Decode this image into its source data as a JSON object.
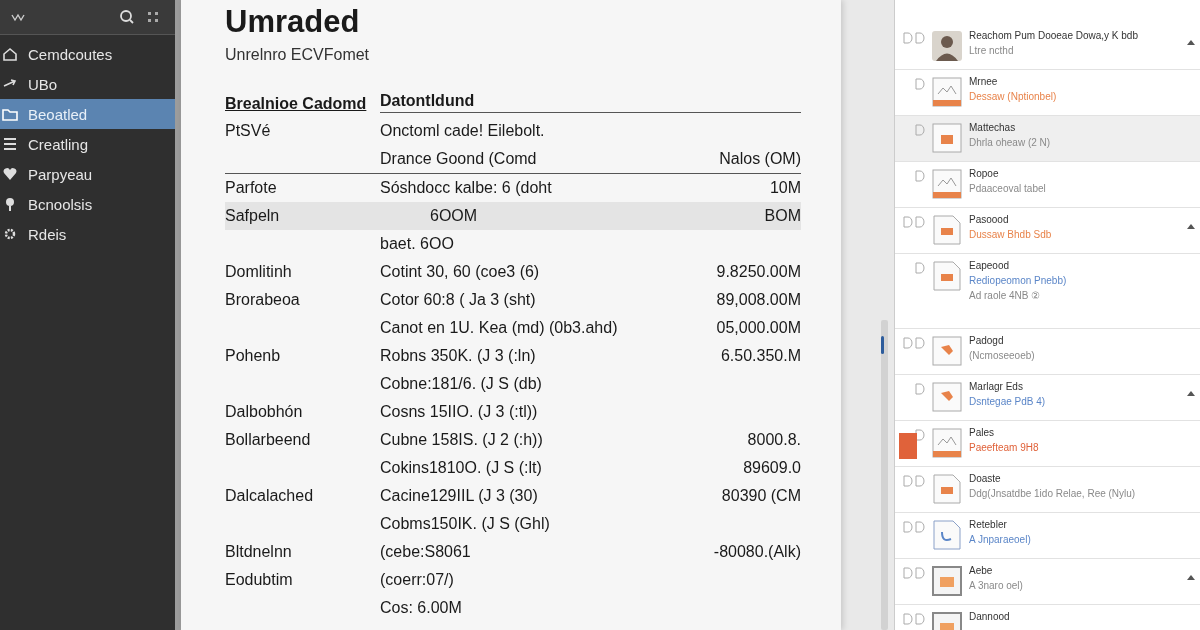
{
  "sidebar": {
    "items": [
      {
        "label": "Cemdcoutes",
        "selected": false
      },
      {
        "label": "UBo",
        "selected": false
      },
      {
        "label": "Beoatled",
        "selected": true
      },
      {
        "label": "Creatling",
        "selected": false
      },
      {
        "label": "Parpyeau",
        "selected": false
      },
      {
        "label": "Bcnoolsis",
        "selected": false
      },
      {
        "label": "Rdeis",
        "selected": false
      }
    ]
  },
  "document": {
    "title": "Umraded",
    "subtitle": "Unrelnro ECVFomet",
    "header": {
      "column_1": "Brealnioe Cadomd",
      "column_2": "Datontldund"
    },
    "rows": [
      {
        "label": "PtSVé",
        "detail": "Onctoml cade! Eilebolt."
      },
      {
        "detail": "Drance Goond (Comd",
        "value": "Nalos (OM)",
        "rule": true
      },
      {
        "label": "Parfote",
        "detail": "Sóshdocc kalbe: 6 (doht",
        "value": "10M"
      },
      {
        "label": "Safpeln",
        "detail": "6OOM",
        "value": "BOM",
        "shaded": true
      },
      {
        "detail": "baet. 6OO"
      },
      {
        "label": "Domlitinh",
        "detail": "Cotint 30, 60 (coe3 (6)",
        "value": "9.8250.00M"
      },
      {
        "label": "Brorabeoa",
        "detail": "Cotor 60:8 ( Ja 3 (sht)",
        "value": "89,008.00M"
      },
      {
        "detail": "Canot en 1U. Kea (md) (0b3.ahd)",
        "value": "05,000.00M"
      },
      {
        "label": "Pohenb",
        "detail": "Robns 350K. (J 3 (:ln)",
        "value": "6.50.350.M"
      },
      {
        "detail": "Cobne:181/6. (J S (db)"
      },
      {
        "label": "Dalbobhón",
        "detail": "Cosns 15IIO. (J 3 (:tl))"
      },
      {
        "label": "Bollarbeend",
        "detail": "Cubne 158IS. (J 2 (:h))",
        "value": "8000.8."
      },
      {
        "detail": "Cokins1810O. (J S (:lt)",
        "value": "89609.0"
      },
      {
        "label": "Dalcalached",
        "detail": "Cacine129IIL (J 3 (30)",
        "value": "80390 (CM"
      },
      {
        "detail": "Cobms150IK. (J S (Ghl)"
      },
      {
        "label": "Bltdnelnn",
        "detail": "(cebe:S8061",
        "value": "-80080.(Alk)"
      },
      {
        "label": "Eodubtim",
        "detail": "(coerr:07/)"
      },
      {
        "detail": "Cos: 6.00M"
      }
    ]
  },
  "list": {
    "items": [
      {
        "title": "Reachom Pum Dooeae Dowa,y K bdb",
        "subtitle": "Ltre ncthd",
        "kind": "plain",
        "expanded": true,
        "selected": false,
        "flagged": false
      },
      {
        "title": "Mrnee",
        "subtitle": "Dessaw (Nptionbel)",
        "kind": "accent",
        "expanded": false,
        "selected": false,
        "flagged": false
      },
      {
        "title": "Mattechas",
        "subtitle": "Dhrla oheaw (2 N)",
        "kind": "plain",
        "expanded": false,
        "selected": true,
        "flagged": false
      },
      {
        "title": "Ropoe",
        "subtitle": "Pdaaceoval tabel",
        "kind": "plain",
        "expanded": false,
        "selected": false,
        "flagged": false
      },
      {
        "title": "Pasoood",
        "subtitle": "Dussaw Bhdb Sdb",
        "kind": "accent",
        "expanded": true,
        "selected": false,
        "flagged": false
      },
      {
        "title": "Eapeood",
        "subtitle": "Rediopeomon Pnebb)",
        "note": "Ad raole 4NB ②",
        "kind": "link",
        "expanded": false,
        "selected": false,
        "flagged": false
      },
      {
        "title": "Padogd",
        "subtitle": "(Ncmoseeoeb)",
        "kind": "plain",
        "expanded": false,
        "selected": false,
        "flagged": false
      },
      {
        "title": "Marlagr Eds",
        "subtitle": "Dsntegae PdB 4)",
        "kind": "link",
        "expanded": true,
        "selected": false,
        "flagged": false
      },
      {
        "title": "Pales",
        "subtitle": "Paeefteam 9H8",
        "kind": "alert",
        "expanded": false,
        "selected": false,
        "flagged": true
      },
      {
        "title": "Doaste",
        "subtitle": "Ddg(Jnsatdbe 1ido Relae, Ree (Nylu)",
        "kind": "plain",
        "expanded": false,
        "selected": false,
        "flagged": false
      },
      {
        "title": "Retebler",
        "subtitle": "A Jnparaeoel)",
        "kind": "link",
        "expanded": false,
        "selected": false,
        "flagged": false
      },
      {
        "title": "Aebe",
        "subtitle": "A 3naro oel)",
        "kind": "plain",
        "expanded": true,
        "selected": false,
        "flagged": false
      },
      {
        "title": "Dannood",
        "expanded": false,
        "selected": false,
        "flagged": false
      }
    ]
  }
}
